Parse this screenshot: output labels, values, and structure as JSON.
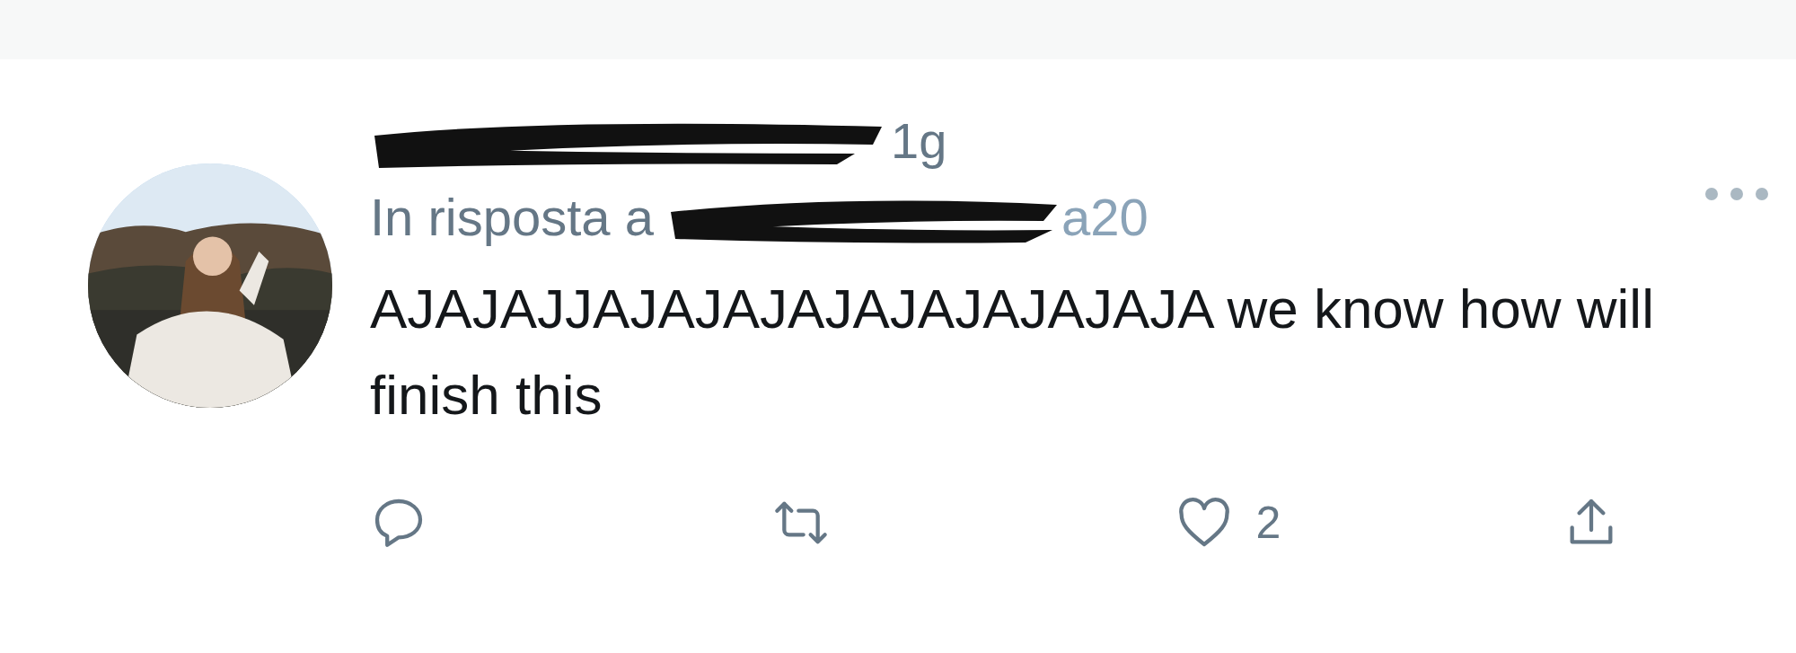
{
  "tweet": {
    "time": "1g",
    "reply_prefix": "In risposta a",
    "reply_handle_tail": "a20",
    "text": "AJAJAJJAJAJAJAJAJAJAJAJAJA we know how will finish this"
  },
  "actions": [
    {
      "kind": "reply"
    },
    {
      "kind": "retweet"
    },
    {
      "kind": "like",
      "count": "2"
    },
    {
      "kind": "share"
    }
  ]
}
